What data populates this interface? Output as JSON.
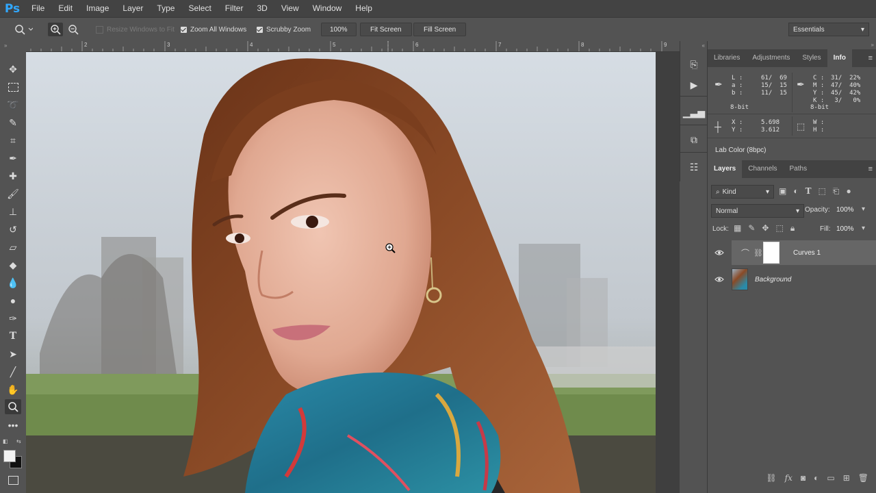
{
  "app": {
    "logo": "Ps"
  },
  "menu": [
    "File",
    "Edit",
    "Image",
    "Layer",
    "Type",
    "Select",
    "Filter",
    "3D",
    "View",
    "Window",
    "Help"
  ],
  "options": {
    "resize_windows": "Resize Windows to Fit",
    "zoom_all": "Zoom All Windows",
    "scrubby": "Scrubby Zoom",
    "zoom_value": "100%",
    "fit_screen": "Fit Screen",
    "fill_screen": "Fill Screen",
    "workspace": "Essentials"
  },
  "ruler": {
    "ticks": [
      "2",
      "3",
      "4",
      "5",
      "6",
      "7",
      "8",
      "9"
    ]
  },
  "info_panel": {
    "tabs": [
      "Libraries",
      "Adjustments",
      "Styles",
      "Info"
    ],
    "active_tab": "Info",
    "lab_labels": "L :\na :\nb :",
    "lab_values": "61/  69\n15/  15\n11/  15",
    "cmyk_labels": "C :\nM :\nY :\nK :",
    "cmyk_values": "31/  22%\n47/  40%\n45/  42%\n 3/   0%",
    "bit_left": "8-bit",
    "bit_right": "8-bit",
    "xy_labels": "X :\nY :",
    "xy_values": "5.698\n3.612",
    "wh_labels": "W :\nH :",
    "doc_info": "Lab Color (8bpc)"
  },
  "layers_panel": {
    "tabs": [
      "Layers",
      "Channels",
      "Paths"
    ],
    "active_tab": "Layers",
    "filter_kind": "Kind",
    "blend_mode": "Normal",
    "opacity_label": "Opacity:",
    "opacity_value": "100%",
    "lock_label": "Lock:",
    "fill_label": "Fill:",
    "fill_value": "100%",
    "layers": [
      {
        "name": "Curves 1",
        "selected": true
      },
      {
        "name": "Background",
        "selected": false
      }
    ]
  },
  "colors": {
    "accent": "#31a8ff",
    "panel_bg": "#535353",
    "menubar_bg": "#434343"
  }
}
